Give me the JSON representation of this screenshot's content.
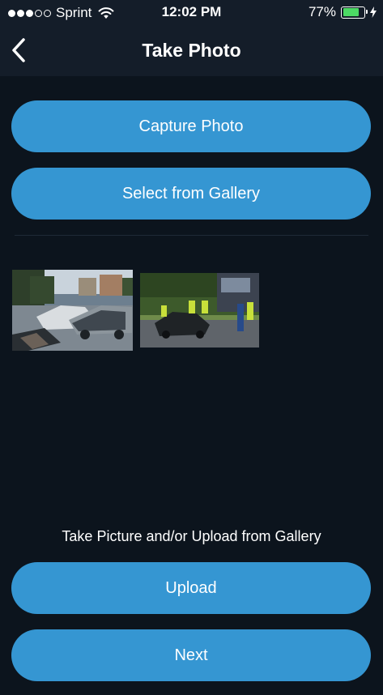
{
  "status_bar": {
    "carrier": "Sprint",
    "time": "12:02 PM",
    "battery": "77%",
    "battery_level": 0.77
  },
  "nav": {
    "title": "Take Photo",
    "back_icon": "chevron-left-icon"
  },
  "actions": {
    "capture_label": "Capture Photo",
    "gallery_label": "Select from Gallery"
  },
  "photos": [
    {
      "subject": "car-crash-street"
    },
    {
      "subject": "car-crash-road-police"
    }
  ],
  "footer": {
    "hint": "Take Picture and/or Upload from Gallery",
    "upload_label": "Upload",
    "next_label": "Next"
  },
  "colors": {
    "background": "#0c141d",
    "bar": "#141d29",
    "button": "#3596d2",
    "battery": "#4cd964"
  }
}
